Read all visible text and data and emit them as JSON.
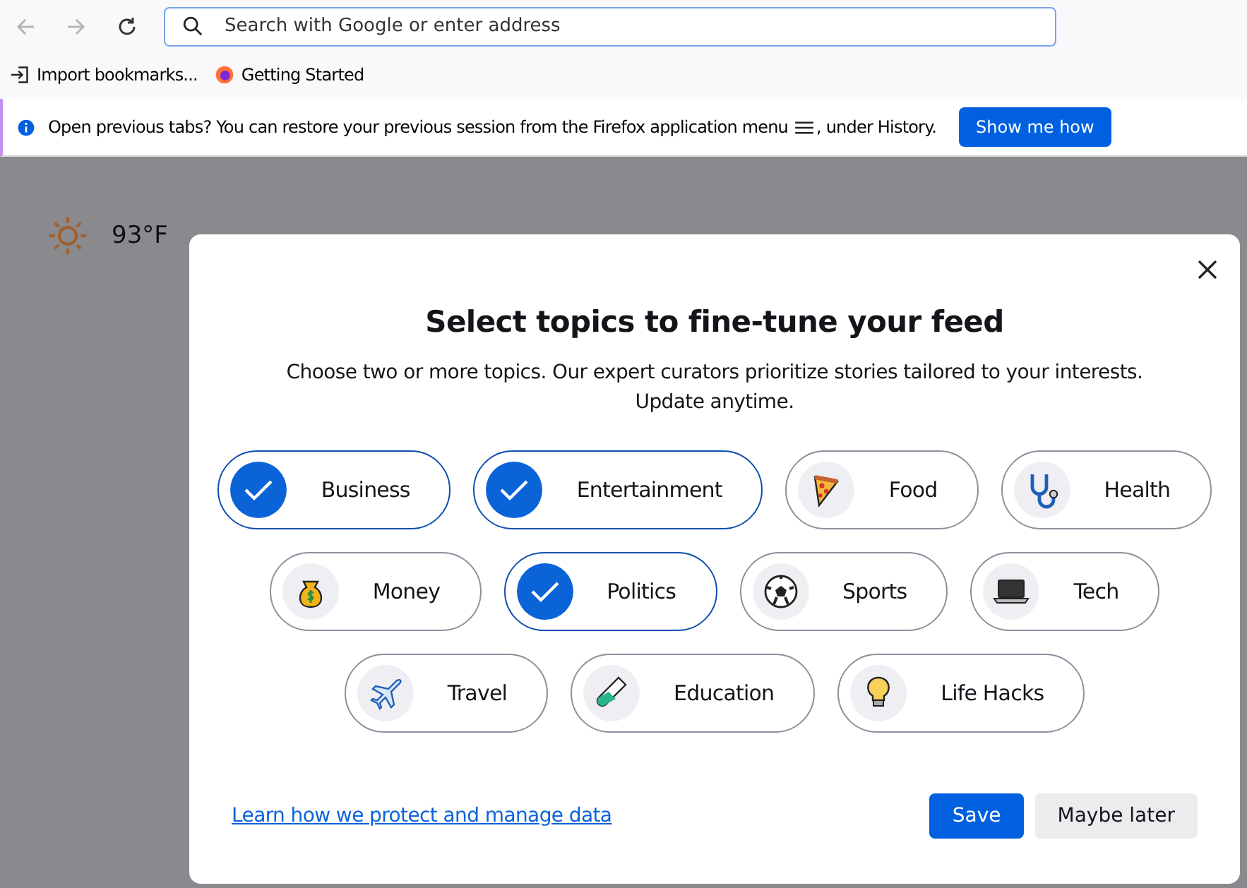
{
  "toolbar": {
    "address_bar": {
      "placeholder": "Search with Google or enter address"
    }
  },
  "bookmarks": [
    {
      "label": "Import bookmarks...",
      "kind": "import"
    },
    {
      "label": "Getting Started",
      "kind": "firefox"
    }
  ],
  "notification": {
    "text": "Open previous tabs? You can restore your previous session from the Firefox application menu",
    "after_icon": ", under History.",
    "button": "Show me how"
  },
  "weather": {
    "temperature": "93°F"
  },
  "dialog": {
    "title": "Select topics to fine-tune your feed",
    "description": "Choose two or more topics. Our expert curators prioritize stories tailored to your interests. Update anytime.",
    "topic_rows": [
      [
        {
          "label": "Business",
          "selected": true
        },
        {
          "label": "Entertainment",
          "selected": true
        },
        {
          "label": "Food",
          "selected": false,
          "kind": "pizza"
        },
        {
          "label": "Health",
          "selected": false,
          "kind": "stethoscope"
        }
      ],
      [
        {
          "label": "Money",
          "selected": false,
          "kind": "moneybag"
        },
        {
          "label": "Politics",
          "selected": true
        },
        {
          "label": "Sports",
          "selected": false,
          "kind": "ball"
        },
        {
          "label": "Tech",
          "selected": false,
          "kind": "laptop"
        }
      ],
      [
        {
          "label": "Travel",
          "selected": false,
          "kind": "plane"
        },
        {
          "label": "Education",
          "selected": false,
          "kind": "tube"
        },
        {
          "label": "Life Hacks",
          "selected": false,
          "kind": "bulb"
        }
      ]
    ],
    "link": "Learn how we protect and manage data",
    "save": "Save",
    "later": "Maybe later"
  }
}
